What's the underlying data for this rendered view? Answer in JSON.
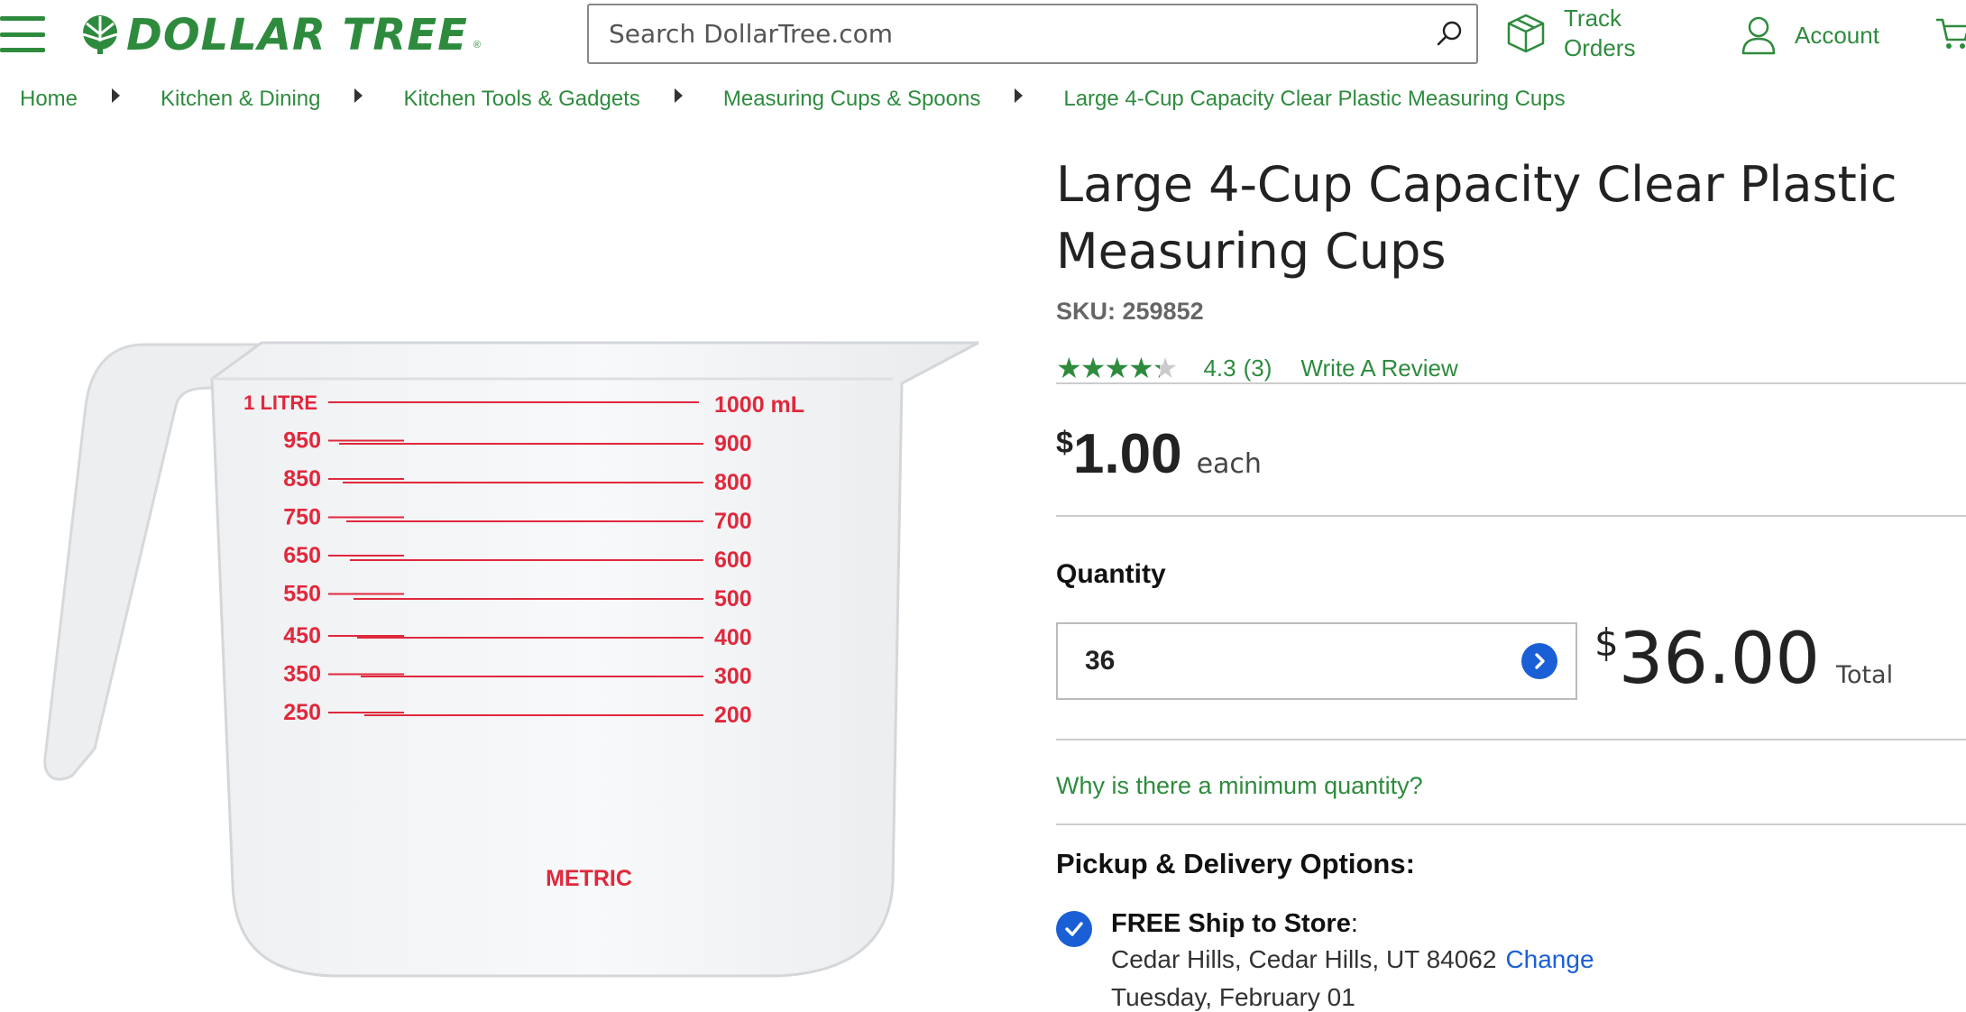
{
  "header": {
    "logo_text": "DOLLAR TREE",
    "logo_reg": "®",
    "search_placeholder": "Search DollarTree.com",
    "track_line1": "Track",
    "track_line2": "Orders",
    "account_label": "Account"
  },
  "breadcrumb": [
    "Home",
    "Kitchen & Dining",
    "Kitchen Tools & Gadgets",
    "Measuring Cups & Spoons",
    "Large 4-Cup Capacity Clear Plastic Measuring Cups"
  ],
  "product": {
    "title": "Large 4-Cup Capacity Clear Plastic Measuring Cups",
    "sku": "SKU: 259852",
    "rating_value": "4.3",
    "rating_count": "(3)",
    "rating_stars": 4.3,
    "write_review": "Write A Review",
    "price_currency": "$",
    "price_amount": "1.00",
    "price_unit": "each",
    "quantity_label": "Quantity",
    "quantity_value": "36",
    "total_currency": "$",
    "total_amount": "36.00",
    "total_label": "Total",
    "min_qty_link": "Why is there a minimum quantity?",
    "pickup_heading": "Pickup & Delivery Options:",
    "ship_title_bold": "FREE Ship to Store",
    "ship_title_colon": ":",
    "ship_address": "Cedar Hills, Cedar Hills, UT 84062",
    "ship_change": "Change",
    "ship_date": "Tuesday, February 01"
  },
  "image_markings": {
    "left": [
      "1 LITRE",
      "950",
      "850",
      "750",
      "650",
      "550",
      "450",
      "350",
      "250"
    ],
    "right": [
      "1000 mL",
      "900",
      "800",
      "700",
      "600",
      "500",
      "400",
      "300",
      "200"
    ],
    "bottom": "METRIC"
  },
  "colors": {
    "brand_green": "#2e8b3e",
    "link_blue": "#1a5fd6",
    "marking_red": "#e0283c"
  },
  "icons": [
    "menu-icon",
    "tree-logo-icon",
    "search-icon",
    "box-icon",
    "user-icon",
    "cart-icon",
    "chevron-right-icon",
    "check-icon"
  ]
}
